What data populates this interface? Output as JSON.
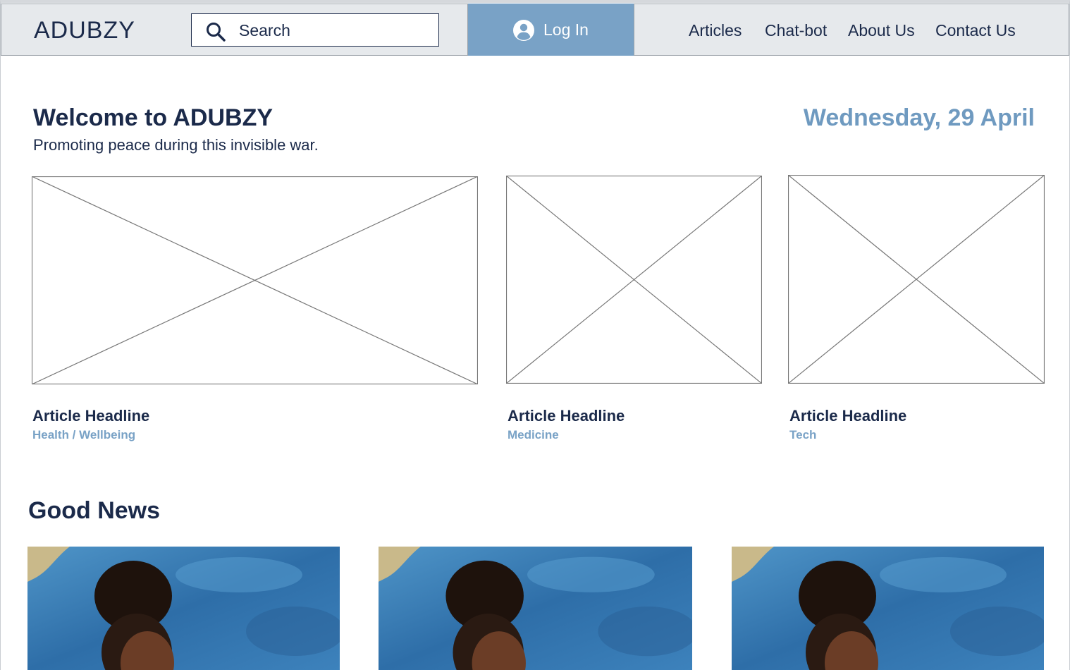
{
  "header": {
    "logo": "ADUBZY",
    "search_placeholder": "Search",
    "login_label": "Log In",
    "nav": [
      "Articles",
      "Chat-bot",
      "About Us",
      "Contact Us"
    ]
  },
  "welcome": {
    "title": "Welcome to ADUBZY",
    "subtitle": "Promoting peace during this invisible war.",
    "date": "Wednesday, 29 April"
  },
  "featured_articles": [
    {
      "headline": "Article Headline",
      "category": "Health / Wellbeing"
    },
    {
      "headline": "Article Headline",
      "category": "Medicine"
    },
    {
      "headline": "Article Headline",
      "category": "Tech"
    }
  ],
  "good_news": {
    "title": "Good News"
  },
  "colors": {
    "navy": "#1b2a4a",
    "accent_blue": "#79a2c6",
    "header_bg": "#e6e9ec"
  }
}
